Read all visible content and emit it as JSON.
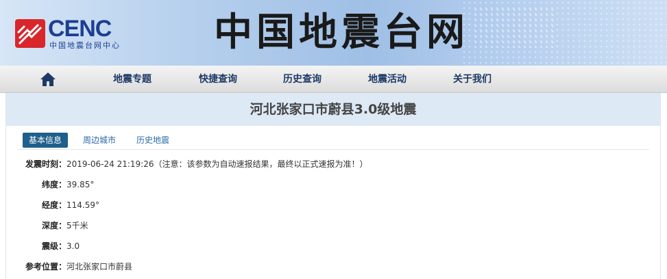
{
  "header": {
    "logo_text": "CENC",
    "logo_subtitle": "中国地震台网中心",
    "site_title": "中国地震台网"
  },
  "nav": {
    "home_icon": "home-icon",
    "items": [
      {
        "label": "地震专题"
      },
      {
        "label": "快捷查询"
      },
      {
        "label": "历史查询"
      },
      {
        "label": "地震活动"
      },
      {
        "label": "关于我们"
      }
    ]
  },
  "page": {
    "title": "河北张家口市蔚县3.0级地震"
  },
  "tabs": [
    {
      "label": "基本信息",
      "active": true
    },
    {
      "label": "周边城市",
      "active": false
    },
    {
      "label": "历史地震",
      "active": false
    }
  ],
  "info": {
    "time_label": "发震时刻：",
    "time_value": "2019-06-24 21:19:26（注意：该参数为自动速报结果，最终以正式速报为准！）",
    "lat_label": "纬度：",
    "lat_value": "39.85°",
    "lon_label": "经度：",
    "lon_value": "114.59°",
    "depth_label": "深度：",
    "depth_value": "5千米",
    "mag_label": "震级：",
    "mag_value": "3.0",
    "loc_label": "参考位置：",
    "loc_value": "河北张家口市蔚县"
  },
  "colors": {
    "brand_blue": "#1d3e92",
    "logo_red": "#d9262b",
    "nav_text": "#1d3a66",
    "title_bar_bg": "#dde9f4",
    "active_tab_bg": "#1f5f8b",
    "tab_link": "#2a6ca8"
  }
}
